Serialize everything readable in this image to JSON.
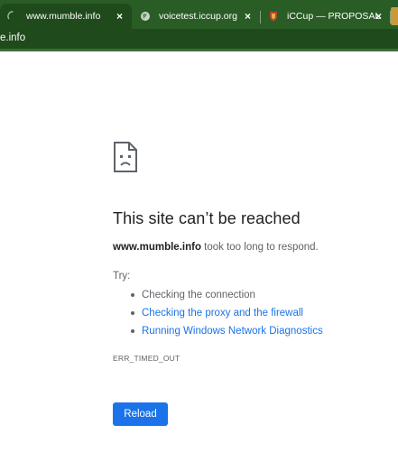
{
  "tabs": [
    {
      "title": "www.mumble.info",
      "close": "×",
      "icon": "loading-spinner-icon"
    },
    {
      "title": "voicetest.iccup.org",
      "close": "×",
      "icon": "globe-icon"
    },
    {
      "title": "iCCup — PROPOSAL",
      "close": "×",
      "icon": "iccup-shield-icon"
    }
  ],
  "toolbar": {
    "url_fragment": "e.info"
  },
  "error": {
    "heading": "This site can’t be reached",
    "host": "www.mumble.info",
    "message_rest": " took too long to respond.",
    "try_label": "Try:",
    "suggestions": [
      "Checking the connection",
      "Checking the proxy and the firewall",
      "Running Windows Network Diagnostics"
    ],
    "code": "ERR_TIMED_OUT",
    "reload_label": "Reload"
  },
  "colors": {
    "chrome": "#2a5c26",
    "toolbar": "#1f4a1c",
    "link": "#1a73e8",
    "button": "#1a73e8"
  }
}
